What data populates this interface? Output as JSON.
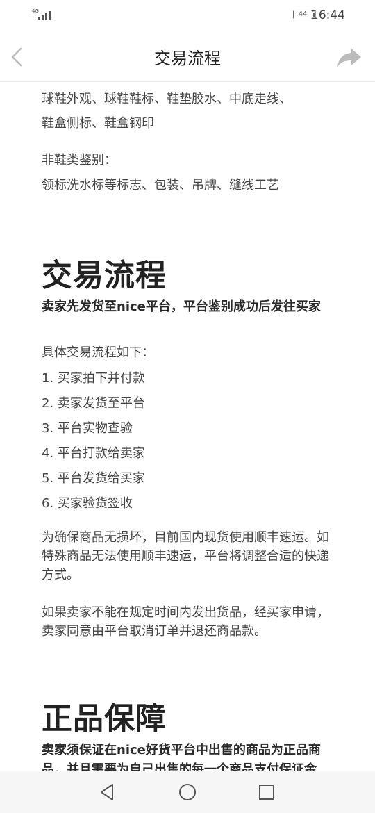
{
  "status_bar": {
    "network": "4G",
    "battery": "44",
    "time": "16:44"
  },
  "nav": {
    "title": "交易流程"
  },
  "content": {
    "shoe_items_line1": "球鞋外观、球鞋鞋标、鞋垫胶水、中底走线、",
    "shoe_items_line2": "鞋盒侧标、鞋盒钢印",
    "non_shoe_label": "非鞋类鉴别：",
    "non_shoe_items": "领标洗水标等标志、包装、吊牌、缝线工艺",
    "trade_heading": "交易流程",
    "trade_lead": "卖家先发货至nice平台，平台鉴别成功后发往买家",
    "flow_intro": "具体交易流程如下：",
    "steps": [
      "1.  买家拍下并付款",
      "2. 卖家发货至平台",
      "3. 平台实物查验",
      "4. 平台打款给卖家",
      "5. 平台发货给买家",
      "6. 买家验货签收"
    ],
    "shipping_note": "为确保商品无损坏，目前国内现货使用顺丰速运。如特殊商品无法使用顺丰速运，平台将调整合适的快递方式。",
    "cancel_note": "如果卖家不能在规定时间内发出货品，经买家申请，卖家同意由平台取消订单并退还商品款。",
    "guarantee_heading": "正品保障",
    "guarantee_lead": "卖家须保证在nice好货平台中出售的商品为正品商品，并且需要为自己出售的每一个商品支付保证金"
  },
  "colors": {
    "text": "#444444",
    "heading": "#222222",
    "icon": "#bbbbbb",
    "nav_bg": "#f6f6f6"
  },
  "icons": {
    "back": "chevron-left-icon",
    "share": "share-arrow-icon",
    "nav_back": "triangle-back-icon",
    "nav_home": "circle-home-icon",
    "nav_recent": "square-recent-icon"
  }
}
